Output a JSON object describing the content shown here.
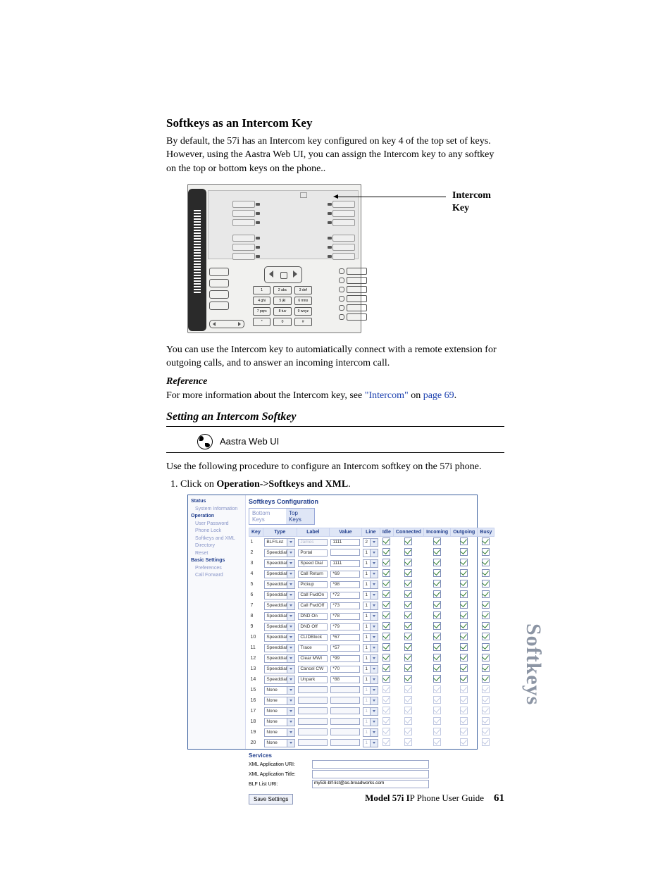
{
  "section": {
    "title": "Softkeys as an Intercom Key",
    "intro": "By default, the 57i has an Intercom key configured on key 4 of the top set of keys. However, using the Aastra Web UI, you can assign the Intercom key to any softkey on the top or bottom keys on the phone..",
    "pointer_label_l1": "Intercom",
    "pointer_label_l2": "Key",
    "usage": "You can use the Intercom key to automiatically connect with a remote extension for outgoing calls, and to answer an incoming intercom call.",
    "ref_heading": "Reference",
    "ref_pre": "For more information about the Intercom key, see ",
    "ref_link": "\"Intercom\"",
    "ref_mid": " on ",
    "ref_page": "page 69",
    "ref_post": ".",
    "sub_heading": "Setting an Intercom Softkey",
    "webui_label": "Aastra Web UI",
    "procedure": "Use the following procedure to configure an Intercom softkey on the 57i phone.",
    "step1_pre": "Click on ",
    "step1_bold": "Operation->Softkeys and XML",
    "step1_post": "."
  },
  "keypad": [
    [
      "1",
      "2 abc",
      "3 def"
    ],
    [
      "4 ghi",
      "5 jkl",
      "6 mno"
    ],
    [
      "7 pqrs",
      "8 tuv",
      "9 wxyz"
    ],
    [
      "*",
      "0",
      "#"
    ]
  ],
  "cfg": {
    "side": {
      "status": "Status",
      "sysinfo": "System Information",
      "operation": "Operation",
      "userpw": "User Password",
      "phonelock": "Phone Lock",
      "softkeys": "Softkeys and XML",
      "directory": "Directory",
      "reset": "Reset",
      "basic": "Basic Settings",
      "prefs": "Preferences",
      "callfwd": "Call Forward"
    },
    "title": "Softkeys Configuration",
    "tab_bottom": "Bottom Keys",
    "tab_top": "Top Keys",
    "headers": [
      "Key",
      "Type",
      "Label",
      "Value",
      "Line",
      "Idle",
      "Connected",
      "Incoming",
      "Outgoing",
      "Busy"
    ],
    "rows": [
      {
        "k": "1",
        "type": "BLF/List",
        "label": "James",
        "value": "1111",
        "line": "2",
        "en": true,
        "dis_label": true
      },
      {
        "k": "2",
        "type": "Speeddial",
        "label": "Portal",
        "value": "",
        "line": "1",
        "en": true
      },
      {
        "k": "3",
        "type": "Speeddial",
        "label": "Speed Dial",
        "value": "1111",
        "line": "1",
        "en": true
      },
      {
        "k": "4",
        "type": "Speeddial",
        "label": "Call Return",
        "value": "*69",
        "line": "1",
        "en": true
      },
      {
        "k": "5",
        "type": "Speeddial",
        "label": "Pickup",
        "value": "*98",
        "line": "1",
        "en": true
      },
      {
        "k": "6",
        "type": "Speeddial",
        "label": "Call FwdOn",
        "value": "*72",
        "line": "1",
        "en": true
      },
      {
        "k": "7",
        "type": "Speeddial",
        "label": "Call FwdOff",
        "value": "*73",
        "line": "1",
        "en": true
      },
      {
        "k": "8",
        "type": "Speeddial",
        "label": "DND On",
        "value": "*78",
        "line": "1",
        "en": true
      },
      {
        "k": "9",
        "type": "Speeddial",
        "label": "DND Off",
        "value": "*79",
        "line": "1",
        "en": true
      },
      {
        "k": "10",
        "type": "Speeddial",
        "label": "CLIDBlock",
        "value": "*67",
        "line": "1",
        "en": true
      },
      {
        "k": "11",
        "type": "Speeddial",
        "label": "Trace",
        "value": "*57",
        "line": "1",
        "en": true
      },
      {
        "k": "12",
        "type": "Speeddial",
        "label": "Clear MWI",
        "value": "*99",
        "line": "1",
        "en": true
      },
      {
        "k": "13",
        "type": "Speeddial",
        "label": "Cancel CW",
        "value": "*70",
        "line": "1",
        "en": true
      },
      {
        "k": "14",
        "type": "Speeddial",
        "label": "Unpark",
        "value": "*88",
        "line": "1",
        "en": true
      },
      {
        "k": "15",
        "type": "None",
        "label": "",
        "value": "",
        "line": "1",
        "en": false
      },
      {
        "k": "16",
        "type": "None",
        "label": "",
        "value": "",
        "line": "1",
        "en": false
      },
      {
        "k": "17",
        "type": "None",
        "label": "",
        "value": "",
        "line": "1",
        "en": false
      },
      {
        "k": "18",
        "type": "None",
        "label": "",
        "value": "",
        "line": "1",
        "en": false
      },
      {
        "k": "19",
        "type": "None",
        "label": "",
        "value": "",
        "line": "1",
        "en": false
      },
      {
        "k": "20",
        "type": "None",
        "label": "",
        "value": "",
        "line": "1",
        "en": false
      }
    ],
    "services": "Services",
    "xml_uri": "XML Application URI:",
    "xml_title": "XML Application Title:",
    "blf_uri": "BLF List URI:",
    "blf_val": "my53i-blf-list@as.broadworks.com",
    "save": "Save Settings"
  },
  "footer": {
    "guide": "Model 57i IP Phone User Guide",
    "page": "61"
  },
  "sidetab": "Softkeys"
}
